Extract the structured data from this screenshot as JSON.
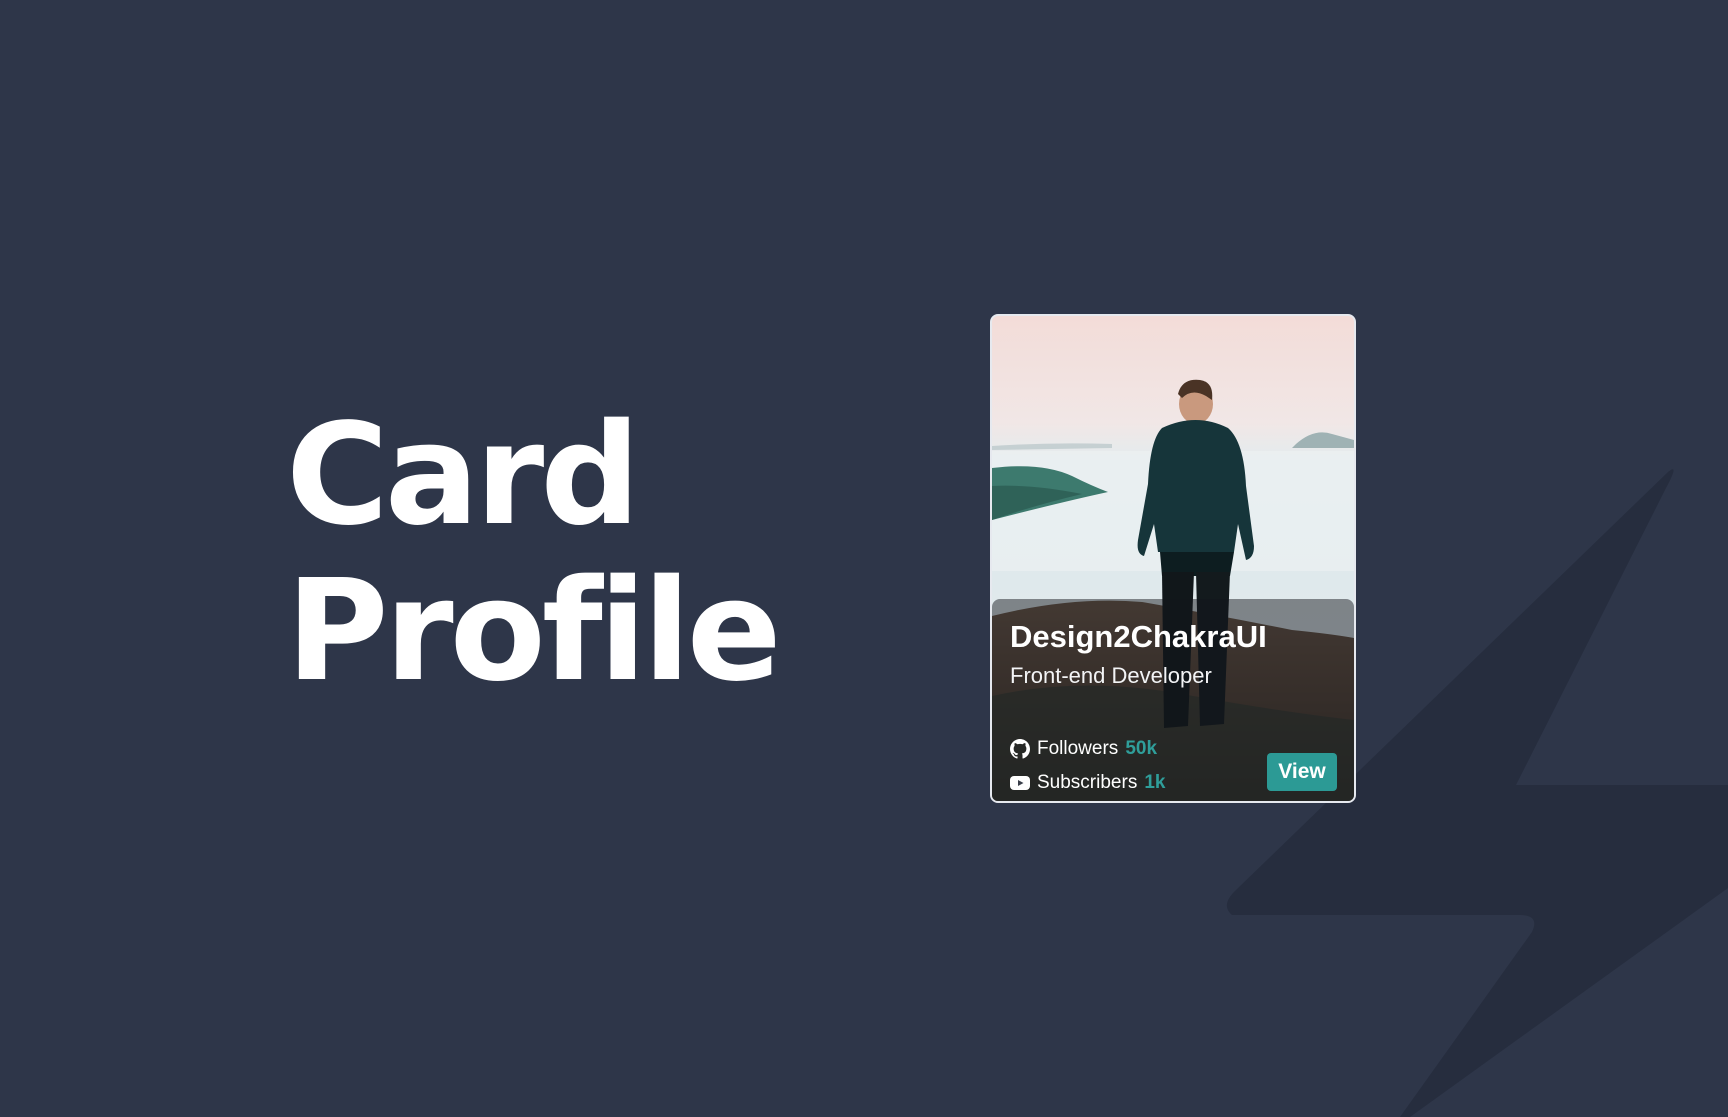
{
  "hero": {
    "line1": "Card",
    "line2": "Profile"
  },
  "card": {
    "name": "Design2ChakraUI",
    "role": "Front-end Developer",
    "stats": [
      {
        "icon": "github-icon",
        "label": "Followers",
        "value": "50k"
      },
      {
        "icon": "youtube-icon",
        "label": "Subscribers",
        "value": "1k"
      }
    ],
    "action_label": "View"
  },
  "colors": {
    "background": "#2e3649",
    "bolt": "#262d3e",
    "accent": "#2c9a95",
    "stat_value": "#2f9e9a"
  }
}
